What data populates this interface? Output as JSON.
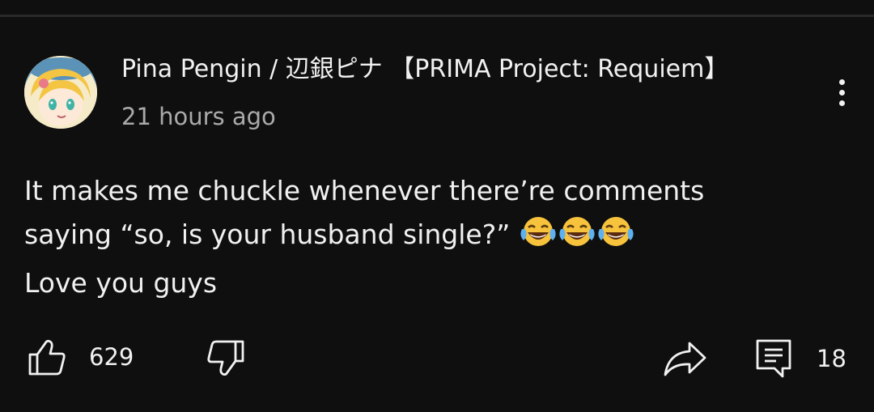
{
  "comment": {
    "author": "Pina Pengin / 辺銀ピナ 【PRIMA Project: Requiem】",
    "timestamp": "21 hours ago",
    "text_lines": [
      "It makes me chuckle whenever there’re comments",
      "saying “so, is your husband single?” ",
      "Love you guys"
    ],
    "emoji": "face-with-tears-of-joy",
    "emoji_count": 3
  },
  "actions": {
    "like_count": "629",
    "reply_count": "18"
  },
  "icons": {
    "menu": "more-vert-icon",
    "like": "thumbs-up-icon",
    "dislike": "thumbs-down-icon",
    "share": "share-arrow-icon",
    "reply": "comment-icon"
  },
  "colors": {
    "background": "#0f0f0f",
    "text_primary": "#f1f1f1",
    "text_secondary": "#aaaaaa"
  }
}
